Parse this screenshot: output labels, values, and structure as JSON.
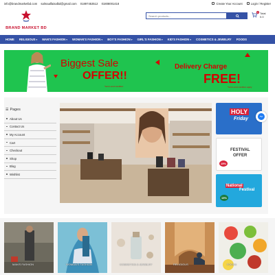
{
  "topbar": {
    "email1": "info@brandmarketbd.com",
    "email2": "salmaalfaisalbd@gmail.com",
    "phone1": "01897453512",
    "phone2": "01808001418",
    "create_account": "Create Your Account",
    "login": "Login / Register"
  },
  "header": {
    "logo_text": "BRAND MARKET BD",
    "search_placeholder": "Search products...",
    "cart_count": "0",
    "cart_label": "Total",
    "cart_amount": "0.0"
  },
  "nav": {
    "items": [
      {
        "label": "HOME",
        "caret": false
      },
      {
        "label": "RELIGIOUS",
        "caret": true
      },
      {
        "label": "MAN'S FASHION",
        "caret": true
      },
      {
        "label": "WOMAN'S FASHION",
        "caret": true
      },
      {
        "label": "BOY'S FASHION",
        "caret": true
      },
      {
        "label": "GIRL'S FASHION",
        "caret": true
      },
      {
        "label": "KID'S FASHION",
        "caret": true
      },
      {
        "label": "COSMETICS & JEWELRY",
        "caret": false
      },
      {
        "label": "FOODS",
        "caret": false
      }
    ]
  },
  "banner": {
    "line1": "Biggest Sale",
    "line2": "OFFER!!",
    "line3": "Delivery Charge",
    "line4": "FREE!",
    "fine1": "*terms and condition",
    "fine2": "*terms and condition apply"
  },
  "sidebar": {
    "title": "Pages",
    "items": [
      "About Us",
      "Contact Us",
      "My Account",
      "Cart",
      "Checkout",
      "Shop",
      "Blog",
      "Wishlist"
    ]
  },
  "promos": {
    "holy1": "HOLY",
    "holy2": "Friday",
    "fest1": "FESTIVAL",
    "fest2": "OFFER",
    "fest_badge": "15%",
    "nat1": "National",
    "nat2": "Festival",
    "nat_badge": "15%"
  },
  "categories": [
    {
      "label": "MAN'S FASHION"
    },
    {
      "label": "WOMAN'S FASHION"
    },
    {
      "label": "COSMETICS & JEWELRY"
    },
    {
      "label": "RELIGIOUS"
    },
    {
      "label": "FOODS"
    }
  ],
  "colors": {
    "nav_blue": "#3552a6",
    "brand_red": "#c8102e",
    "banner_green": "#1fc44f"
  }
}
